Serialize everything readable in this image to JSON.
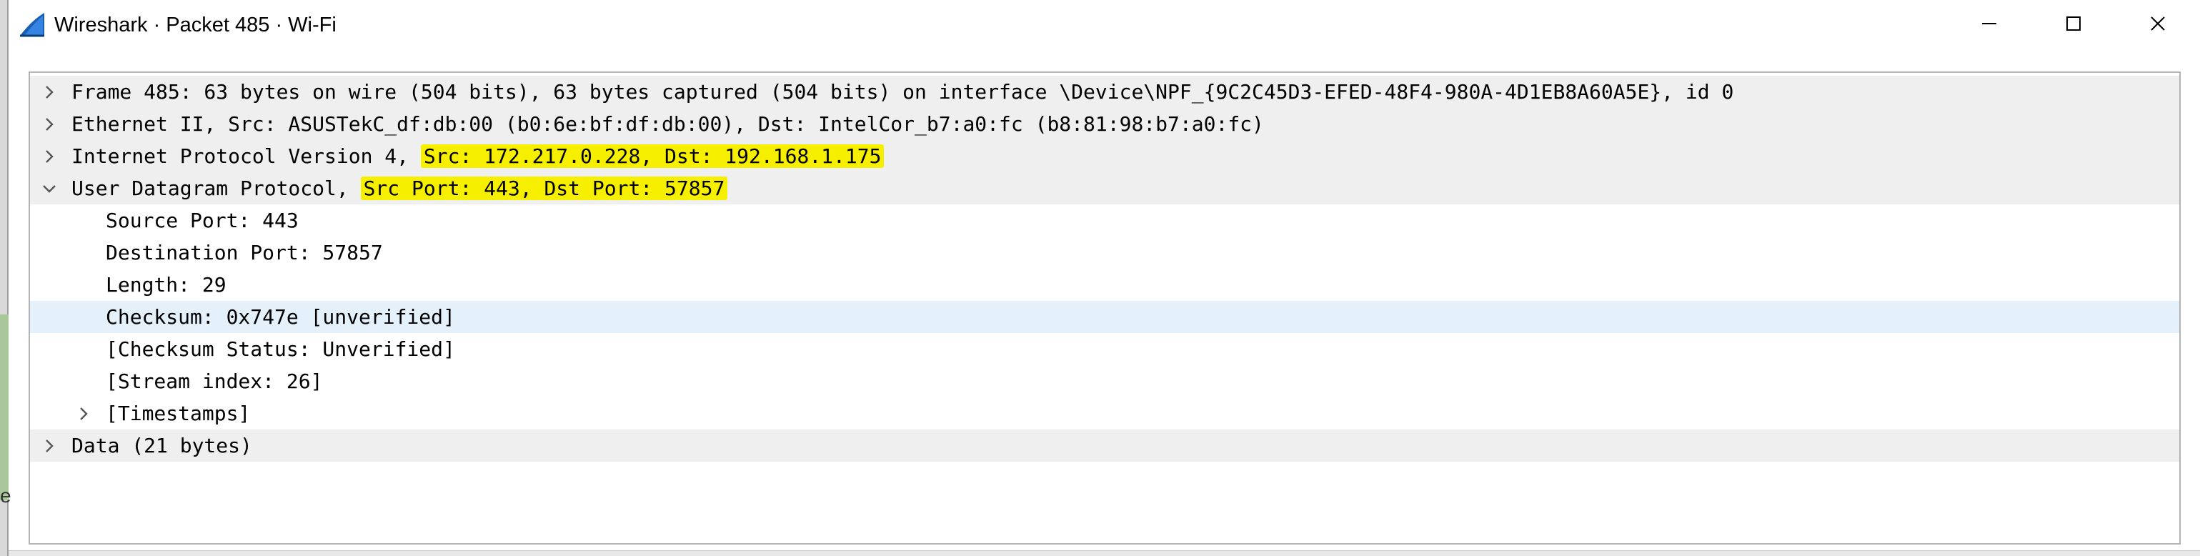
{
  "window": {
    "title": "Wireshark · Packet 485 · Wi-Fi",
    "app_icon": "wireshark-fin-icon",
    "controls": [
      "minimize-icon",
      "maximize-icon",
      "close-icon"
    ]
  },
  "colors": {
    "highlight": "#f7ef00",
    "row_shaded": "#efefef",
    "row_selected": "#e4f1fb",
    "icon_blue": "#1a5fb4"
  },
  "tree": {
    "frame": {
      "text": "Frame 485: 63 bytes on wire (504 bits), 63 bytes captured (504 bits) on interface \\Device\\NPF_{9C2C45D3-EFED-48F4-980A-4D1EB8A60A5E}, id 0",
      "expanded": false
    },
    "ethernet": {
      "text": "Ethernet II, Src: ASUSTekC_df:db:00 (b0:6e:bf:df:db:00), Dst: IntelCor_b7:a0:fc (b8:81:98:b7:a0:fc)",
      "expanded": false
    },
    "ip": {
      "prefix": "Internet Protocol Version 4, ",
      "highlight": "Src: 172.217.0.228, Dst: 192.168.1.175",
      "expanded": false
    },
    "udp": {
      "prefix": "User Datagram Protocol, ",
      "highlight": "Src Port: 443, Dst Port: 57857",
      "expanded": true,
      "children": [
        "Source Port: 443",
        "Destination Port: 57857",
        "Length: 29",
        "Checksum: 0x747e [unverified]",
        "[Checksum Status: Unverified]",
        "[Stream index: 26]",
        "[Timestamps]"
      ],
      "selected_child": 3
    },
    "data": {
      "text": "Data (21 bytes)",
      "expanded": false
    }
  }
}
